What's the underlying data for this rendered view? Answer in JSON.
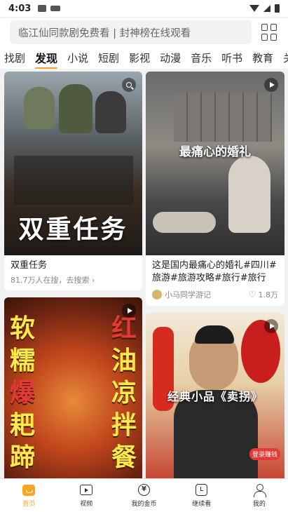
{
  "status_bar": {
    "time": "4:03"
  },
  "search": {
    "placeholder": "临江仙同款剧免费看 | 封神榜在线观看"
  },
  "tabs": [
    "找剧",
    "发现",
    "小说",
    "短剧",
    "影视",
    "动漫",
    "音乐",
    "听书",
    "教育",
    "关"
  ],
  "active_tab": 1,
  "cards": {
    "card1": {
      "poster_text": "双重任务",
      "title": "双重任务",
      "sub": "81.7万人在搜，去搜索 ›",
      "badge": "search-icon"
    },
    "card2": {
      "poster_text": "最痛心的婚礼",
      "title": "这是国内最痛心的婚礼#四川#旅游#旅游攻略#旅行#旅行推...",
      "author": "小马同学游记",
      "likes": "1.8万",
      "badge": "play-icon"
    },
    "card3": {
      "left_text": [
        "软",
        "糯",
        "爆",
        "耙",
        "蹄"
      ],
      "right_text": [
        "红",
        "油",
        "凉",
        "拌",
        "餐"
      ],
      "badge": "play-icon"
    },
    "card4": {
      "poster_text": "经典小品《卖拐》",
      "coin_badge": "登录赚钱",
      "badge": "play-icon"
    }
  },
  "bottom_nav": [
    {
      "label": "首页",
      "icon": "home-icon"
    },
    {
      "label": "视频",
      "icon": "video-icon"
    },
    {
      "label": "我的金币",
      "icon": "coin-icon"
    },
    {
      "label": "继续看",
      "icon": "history-icon"
    },
    {
      "label": "我的",
      "icon": "user-icon"
    }
  ],
  "colors": {
    "accent": "#f5a623"
  }
}
